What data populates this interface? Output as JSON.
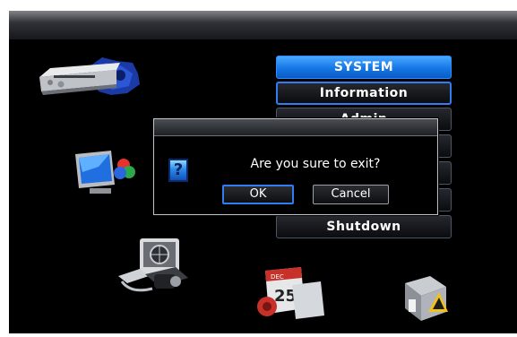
{
  "menu": {
    "header": "SYSTEM",
    "items": [
      {
        "label": "Information"
      },
      {
        "label": "Admin"
      },
      {
        "label": ""
      },
      {
        "label": ""
      },
      {
        "label": ""
      },
      {
        "label": "Shutdown"
      }
    ]
  },
  "icons": {
    "dvr": "dvr-device-icon",
    "display": "display-icon",
    "camera": "camera-network-icon",
    "schedule": "calendar-schedule-icon",
    "tools": "system-tools-icon",
    "calendar_month": "DEC",
    "calendar_day": "25"
  },
  "dialog": {
    "icon": "?",
    "message": "Are you sure to exit?",
    "ok_label": "OK",
    "cancel_label": "Cancel"
  },
  "colors": {
    "accent": "#1f7fe8",
    "selection_border": "#2f7df0",
    "background": "#000000"
  }
}
